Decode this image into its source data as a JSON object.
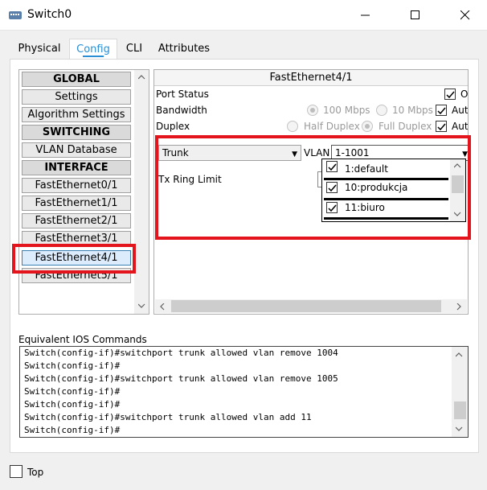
{
  "window": {
    "title": "Switch0"
  },
  "tabs": [
    "Physical",
    "Config",
    "CLI",
    "Attributes"
  ],
  "sidebar": {
    "items": [
      {
        "label": "GLOBAL",
        "header": true
      },
      {
        "label": "Settings"
      },
      {
        "label": "Algorithm Settings"
      },
      {
        "label": "SWITCHING",
        "header": true
      },
      {
        "label": "VLAN Database"
      },
      {
        "label": "INTERFACE",
        "header": true
      },
      {
        "label": "FastEthernet0/1"
      },
      {
        "label": "FastEthernet1/1"
      },
      {
        "label": "FastEthernet2/1"
      },
      {
        "label": "FastEthernet3/1"
      },
      {
        "label": "FastEthernet4/1",
        "selected": true
      },
      {
        "label": "FastEthernet5/1"
      }
    ]
  },
  "interface": {
    "title": "FastEthernet4/1",
    "port_status_label": "Port Status",
    "port_status_cut": "O",
    "bandwidth_label": "Bandwidth",
    "bw_100": "100 Mbps",
    "bw_10": "10 Mbps",
    "auto_cut": "Aut",
    "duplex_label": "Duplex",
    "half": "Half Duplex",
    "full": "Full Duplex",
    "mode": "Trunk",
    "vlan_label": "VLAN",
    "vlan_value": "1-1001",
    "tx_ring": "Tx Ring Limit",
    "vlans": [
      {
        "label": "1:default",
        "checked": true
      },
      {
        "label": "10:produkcja",
        "checked": true
      },
      {
        "label": "11:biuro",
        "checked": true
      }
    ]
  },
  "ios": {
    "label": "Equivalent IOS Commands",
    "lines": [
      "Switch(config-if)#switchport trunk allowed vlan remove 1004",
      "Switch(config-if)#",
      "Switch(config-if)#switchport trunk allowed vlan remove 1005",
      "Switch(config-if)#",
      "Switch(config-if)#",
      "Switch(config-if)#switchport trunk allowed vlan add 11",
      "Switch(config-if)#"
    ]
  },
  "footer": {
    "top_label": "Top"
  },
  "colors": {
    "highlight": "#e3141b",
    "tab_accent": "#2a8fd4"
  }
}
